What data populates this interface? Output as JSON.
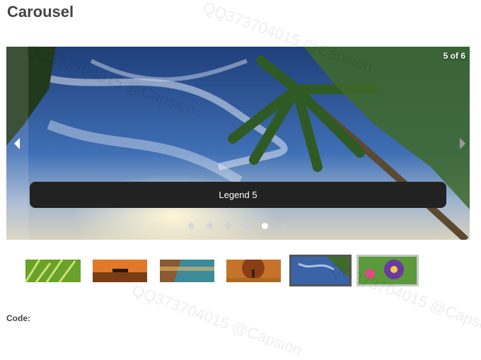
{
  "page": {
    "title": "Carousel"
  },
  "carousel": {
    "counter": "5 of 6",
    "caption": "Legend 5",
    "dots_count": 6,
    "active_dot": 5,
    "thumbnails": [
      {
        "name": "thumb-grass",
        "state": "normal"
      },
      {
        "name": "thumb-sunset-boat",
        "state": "normal"
      },
      {
        "name": "thumb-coast",
        "state": "normal"
      },
      {
        "name": "thumb-autumn-tree",
        "state": "normal"
      },
      {
        "name": "thumb-palm-sky",
        "state": "active"
      },
      {
        "name": "thumb-pansy-flowers",
        "state": "next"
      }
    ]
  },
  "code": {
    "label": "Code:"
  },
  "watermarks": [
    "QQ373704015 @Capsion",
    "QQ373704015 @Capsion",
    "QQ373704015 @Capsion",
    "QQ373704015 @Capsion"
  ],
  "colors": {
    "caption_bg": "#222222",
    "active_thumb_border": "#555555",
    "next_thumb_border": "#c8c8c8"
  }
}
